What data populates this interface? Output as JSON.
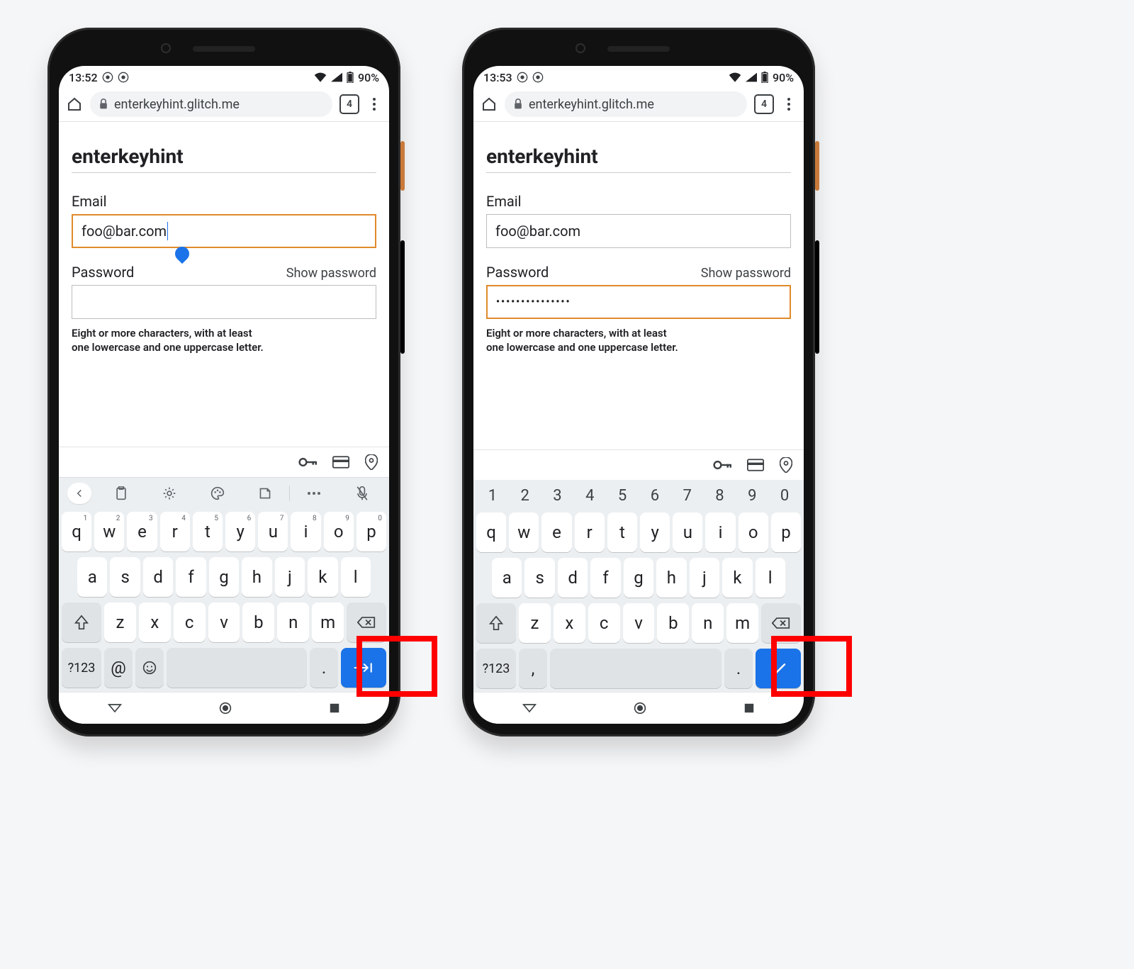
{
  "phones": {
    "left": {
      "statusbar": {
        "time": "13:52",
        "battery_text": "90%"
      },
      "omnibar": {
        "url": "enterkeyhint.glitch.me",
        "tab_count": "4"
      },
      "page": {
        "title": "enterkeyhint",
        "email_label": "Email",
        "email_value": "foo@bar.com",
        "password_label": "Password",
        "show_password": "Show password",
        "password_masked": "",
        "helper_l1": "Eight or more characters, with at least",
        "helper_l2": "one lowercase and one uppercase letter."
      },
      "keyboard": {
        "symbols_label": "?123",
        "row1": [
          {
            "main": "q",
            "sup": "1"
          },
          {
            "main": "w",
            "sup": "2"
          },
          {
            "main": "e",
            "sup": "3"
          },
          {
            "main": "r",
            "sup": "4"
          },
          {
            "main": "t",
            "sup": "5"
          },
          {
            "main": "y",
            "sup": "6"
          },
          {
            "main": "u",
            "sup": "7"
          },
          {
            "main": "i",
            "sup": "8"
          },
          {
            "main": "o",
            "sup": "9"
          },
          {
            "main": "p",
            "sup": "0"
          }
        ],
        "row2": [
          "a",
          "s",
          "d",
          "f",
          "g",
          "h",
          "j",
          "k",
          "l"
        ],
        "row3": [
          "z",
          "x",
          "c",
          "v",
          "b",
          "n",
          "m"
        ],
        "at": "@",
        "period": ".",
        "enter_hint": "next"
      }
    },
    "right": {
      "statusbar": {
        "time": "13:53",
        "battery_text": "90%"
      },
      "omnibar": {
        "url": "enterkeyhint.glitch.me",
        "tab_count": "4"
      },
      "page": {
        "title": "enterkeyhint",
        "email_label": "Email",
        "email_value": "foo@bar.com",
        "password_label": "Password",
        "show_password": "Show password",
        "password_masked": "•••••••••••••••",
        "helper_l1": "Eight or more characters, with at least",
        "helper_l2": "one lowercase and one uppercase letter."
      },
      "keyboard": {
        "symbols_label": "?123",
        "numrow": [
          "1",
          "2",
          "3",
          "4",
          "5",
          "6",
          "7",
          "8",
          "9",
          "0"
        ],
        "row1": [
          {
            "main": "q"
          },
          {
            "main": "w"
          },
          {
            "main": "e"
          },
          {
            "main": "r"
          },
          {
            "main": "t"
          },
          {
            "main": "y"
          },
          {
            "main": "u"
          },
          {
            "main": "i"
          },
          {
            "main": "o"
          },
          {
            "main": "p"
          }
        ],
        "row2": [
          "a",
          "s",
          "d",
          "f",
          "g",
          "h",
          "j",
          "k",
          "l"
        ],
        "row3": [
          "z",
          "x",
          "c",
          "v",
          "b",
          "n",
          "m"
        ],
        "comma": ",",
        "period": ".",
        "enter_hint": "done"
      }
    }
  }
}
